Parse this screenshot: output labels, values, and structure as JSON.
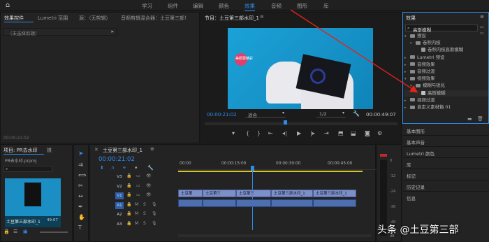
{
  "topbar": {
    "workspaces": [
      "学习",
      "组件",
      "编辑",
      "颜色",
      "效果",
      "音频",
      "图形",
      "库"
    ],
    "active": "效果"
  },
  "effect_controls": {
    "tabs": [
      "效果控件",
      "Lumetri 范围",
      "源：（无剪辑）",
      "音频剪辑混合器：土豆第三部！"
    ],
    "no_clip": "（未选择剪辑）",
    "timecode": "00:00:21:02"
  },
  "program": {
    "tab": "节目：土豆第三部水印_1",
    "timecode": "00:00:21:02",
    "fit": "适合",
    "resolution": "1/2",
    "duration": "00:00:49:07",
    "watermark": "美顔更精彩"
  },
  "effects_panel": {
    "title": "效果",
    "search_value": "高斯模糊",
    "tree": [
      {
        "label": "预设",
        "level": 0,
        "type": "folder",
        "open": true
      },
      {
        "label": "卷积内核",
        "level": 1,
        "type": "folder",
        "open": true
      },
      {
        "label": "卷积内核高斯模糊",
        "level": 2,
        "type": "effect"
      },
      {
        "label": "Lumetri 预设",
        "level": 0,
        "type": "folder"
      },
      {
        "label": "音频效果",
        "level": 0,
        "type": "folder"
      },
      {
        "label": "音频过渡",
        "level": 0,
        "type": "folder"
      },
      {
        "label": "视频效果",
        "level": 0,
        "type": "folder",
        "open": true
      },
      {
        "label": "模糊与锐化",
        "level": 1,
        "type": "folder",
        "open": true
      },
      {
        "label": "高斯模糊",
        "level": 2,
        "type": "effect",
        "highlight": true
      },
      {
        "label": "视频过渡",
        "level": 0,
        "type": "folder"
      },
      {
        "label": "自定义素材箱 01",
        "level": 0,
        "type": "folder"
      }
    ]
  },
  "right_menu": [
    "基本图形",
    "基本声音",
    "Lumetri 颜色",
    "库",
    "标记",
    "历史记录",
    "信息"
  ],
  "project": {
    "tabs": [
      "项目: PR去水印",
      "媒"
    ],
    "file": "PR去水印.prproj",
    "clip_name": "土豆第三部水印_1",
    "clip_duration": "49:07"
  },
  "timeline": {
    "tab": "土豆第三部水印_1",
    "timecode": "00:00:21:02",
    "ruler": [
      "00:00",
      "00:00:15:00",
      "00:00:30:00",
      "00:00:45:00"
    ],
    "video_tracks": [
      "V3",
      "V2",
      "V1"
    ],
    "audio_tracks": [
      "A1",
      "A2",
      "A3"
    ],
    "clips": [
      "土豆第",
      "土豆第三",
      "土豆第三",
      "土豆第三部水印_1",
      "土豆第三部水印_1"
    ]
  },
  "meter_labels": [
    "0",
    "-12",
    "-24",
    "-36",
    "-48",
    "dB"
  ],
  "watermark_caption": "头条 @土豆第三部",
  "colors": {
    "accent": "#2d8ceb",
    "arrow": "#e0231b",
    "clip": "#7b8fc9",
    "audio_clip": "#4d6fb0"
  }
}
